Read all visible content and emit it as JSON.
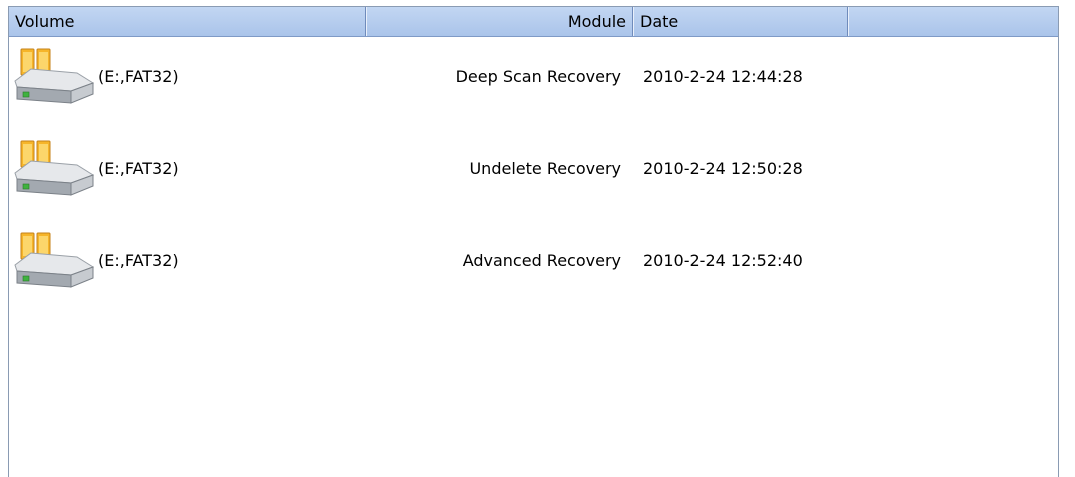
{
  "columns": {
    "volume": "Volume",
    "module": "Module",
    "date": "Date",
    "extra": ""
  },
  "rows": [
    {
      "icon": "hard-drive-folder-icon",
      "volume": "(E:,FAT32)",
      "module": "Deep Scan Recovery",
      "date": "2010-2-24 12:44:28"
    },
    {
      "icon": "hard-drive-folder-icon",
      "volume": "(E:,FAT32)",
      "module": "Undelete Recovery",
      "date": "2010-2-24 12:50:28"
    },
    {
      "icon": "hard-drive-folder-icon",
      "volume": "(E:,FAT32)",
      "module": "Advanced Recovery",
      "date": "2010-2-24 12:52:40"
    }
  ],
  "colors": {
    "header_bg": "#aac4ea",
    "header_border": "#6f8bbb",
    "folder_orange": "#f0a91e",
    "drive_gray": "#8a8f96",
    "led_green": "#3fb23f"
  }
}
